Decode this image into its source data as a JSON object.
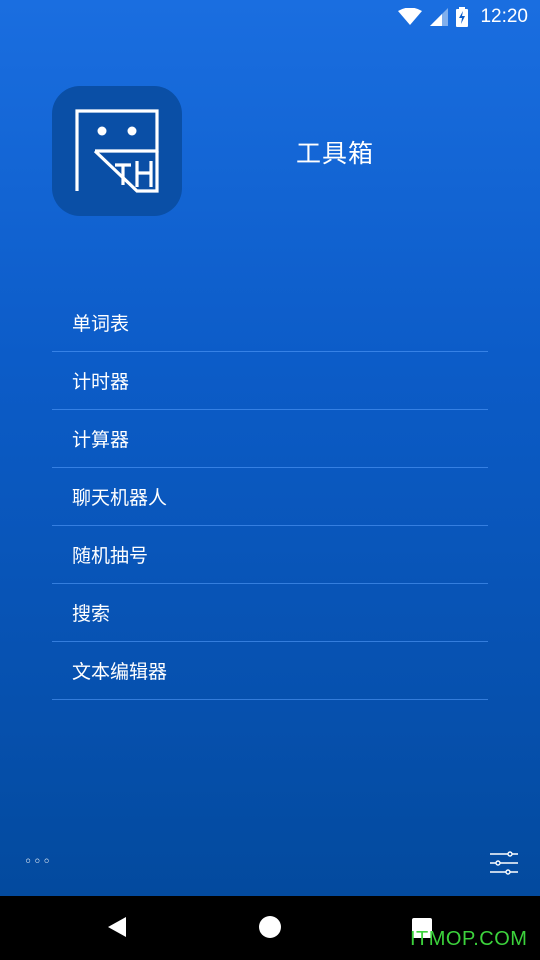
{
  "status_bar": {
    "time": "12:20",
    "icons": [
      "wifi-icon",
      "signal-icon",
      "battery-charging-icon"
    ]
  },
  "header": {
    "app_title": "工具箱",
    "logo_icon": "app-logo-icon"
  },
  "menu": {
    "items": [
      {
        "label": "单词表"
      },
      {
        "label": "计时器"
      },
      {
        "label": "计算器"
      },
      {
        "label": "聊天机器人"
      },
      {
        "label": "随机抽号"
      },
      {
        "label": "搜索"
      },
      {
        "label": "文本编辑器"
      }
    ]
  },
  "footer": {
    "more_icon": "more-dots-icon",
    "more_text": "◦◦◦",
    "settings_icon": "sliders-icon"
  },
  "nav_bar": {
    "icons": [
      "back-icon",
      "home-icon",
      "recent-apps-icon"
    ]
  },
  "watermark": "ITMOP.COM",
  "colors": {
    "background_top": "#1a6ee0",
    "background_bottom": "#034a9e",
    "logo_bg": "#0a4fa6",
    "divider": "#5aa0ff",
    "watermark": "#3cd23c"
  }
}
